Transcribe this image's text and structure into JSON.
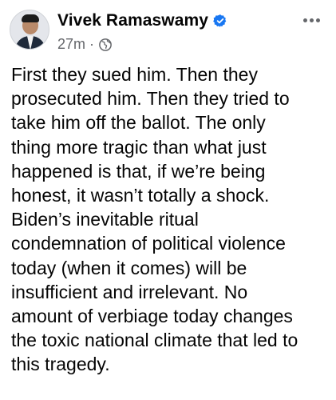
{
  "post": {
    "author_name": "Vivek Ramaswamy",
    "verified": true,
    "timestamp": "27m",
    "separator": "·",
    "audience_icon": "globe-icon",
    "more_icon": "more-options-icon",
    "body_text": "First they sued him. Then they\nprosecuted him. Then they tried to\ntake him off the ballot. The only\nthing more tragic than what just\nhappened is that, if we’re being\nhonest, it wasn’t totally a shock.\nBiden’s inevitable ritual\ncondemnation of political violence\ntoday (when it comes) will be\ninsufficient and irrelevant. No\namount of verbiage today changes\nthe toxic national climate that led to\nthis tragedy."
  },
  "colors": {
    "verified_badge": "#1877f2",
    "meta_text": "#65676b",
    "body_text": "#050505"
  }
}
